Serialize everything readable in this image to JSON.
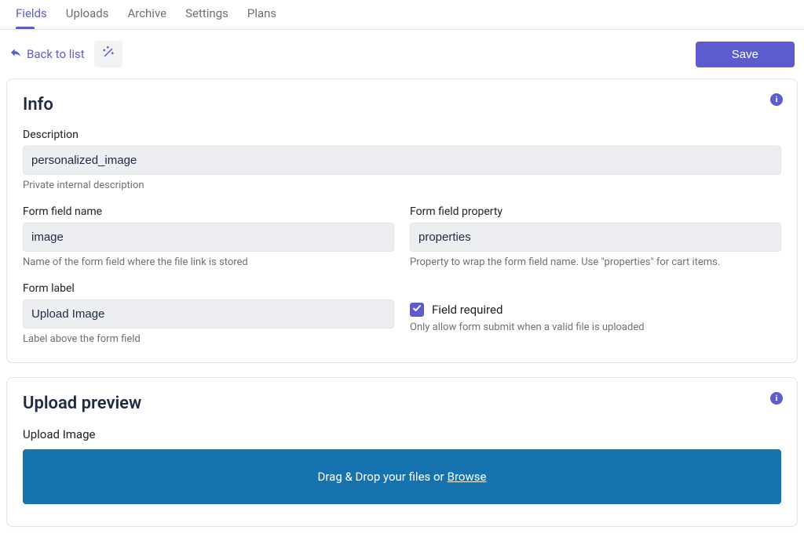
{
  "tabs": {
    "fields": "Fields",
    "uploads": "Uploads",
    "archive": "Archive",
    "settings": "Settings",
    "plans": "Plans"
  },
  "toolbar": {
    "back_label": "Back to list",
    "save_label": "Save"
  },
  "info_card": {
    "title": "Info",
    "description": {
      "label": "Description",
      "value": "personalized_image",
      "help": "Private internal description"
    },
    "form_field_name": {
      "label": "Form field name",
      "value": "image",
      "help": "Name of the form field where the file link is stored"
    },
    "form_field_property": {
      "label": "Form field property",
      "value": "properties",
      "help": "Property to wrap the form field name. Use \"properties\" for cart items."
    },
    "form_label": {
      "label": "Form label",
      "value": "Upload Image",
      "help": "Label above the form field"
    },
    "field_required": {
      "label": "Field required",
      "help": "Only allow form submit when a valid file is uploaded",
      "checked": true
    }
  },
  "preview_card": {
    "title": "Upload preview",
    "upload_label": "Upload Image",
    "dropzone_text": "Drag & Drop your files or",
    "browse_text": "Browse"
  }
}
